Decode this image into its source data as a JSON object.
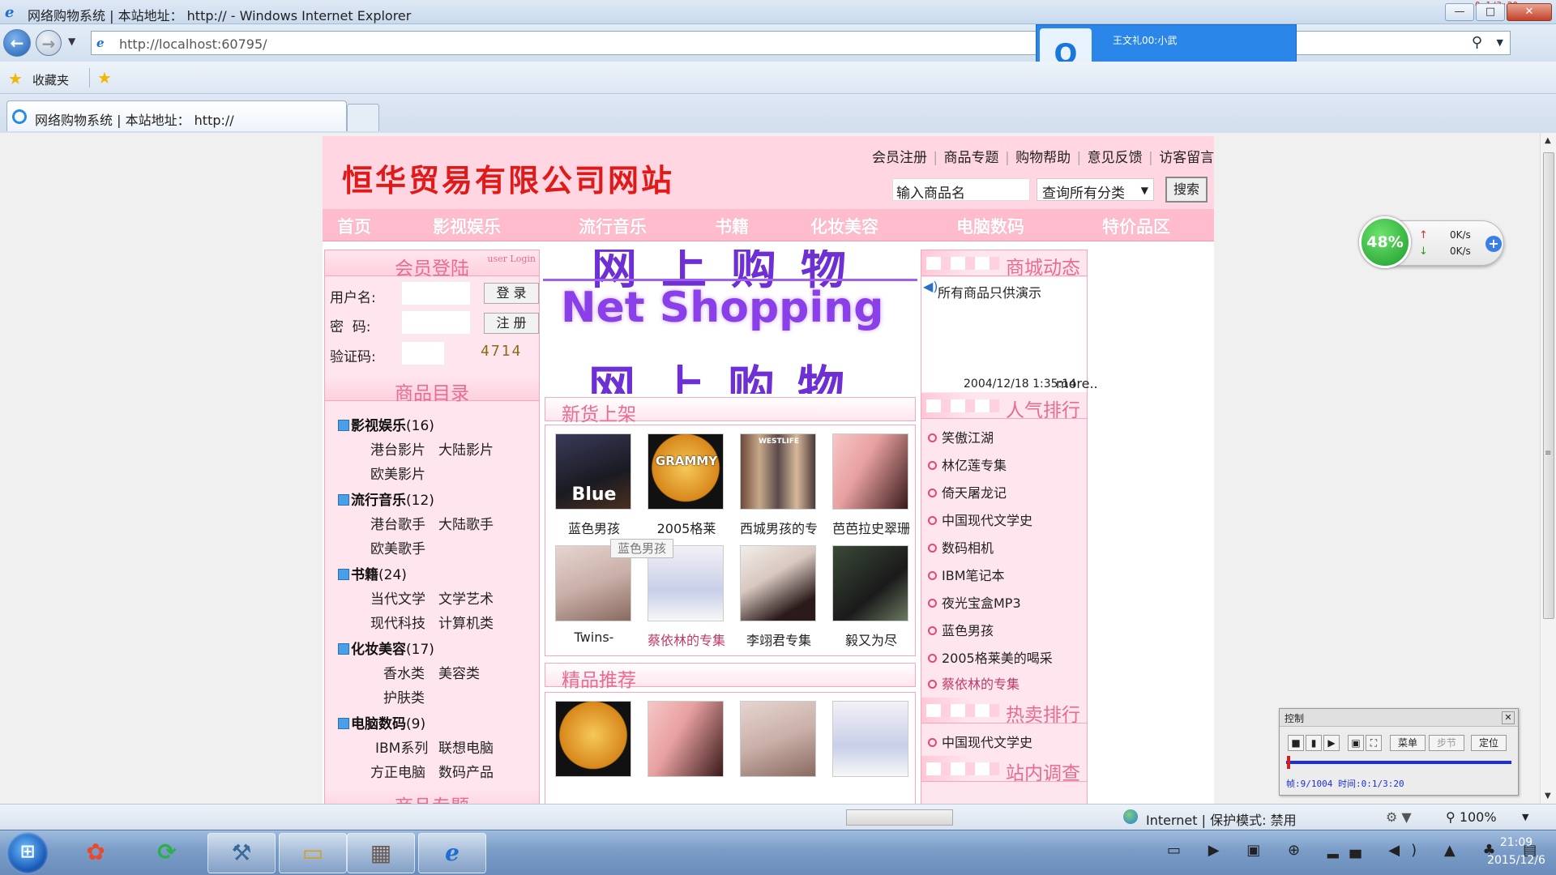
{
  "window": {
    "title": "网络购物系统 | 本站地址： http:// - Windows Internet Explorer",
    "minimize": "—",
    "maximize": "□",
    "close": "✕",
    "rec_time": "0:1/3:20"
  },
  "browser": {
    "url": "http://localhost:60795/",
    "favorites_label": "收藏夹",
    "tab_title": "网络购物系统 | 本站地址： http://"
  },
  "qq": {
    "avatar": "Q",
    "name": "王文礼00:小武"
  },
  "site": {
    "title": "恒华贸易有限公司网站",
    "top_links": [
      "会员注册",
      "商品专题",
      "购物帮助",
      "意见反馈",
      "访客留言"
    ],
    "search_placeholder": "输入商品名",
    "category_select": "查询所有分类",
    "search_button": "搜索",
    "nav": [
      "首页",
      "影视娱乐",
      "流行音乐",
      "书籍",
      "化妆美容",
      "电脑数码",
      "特价品区"
    ]
  },
  "login": {
    "title": "会员登陆",
    "subtitle": "user Login",
    "username_label": "用户名:",
    "password_label": "密  码:",
    "captcha_label": "验证码:",
    "login_button": "登 录",
    "register_button": "注 册",
    "captcha": "4714"
  },
  "catalog": {
    "title": "商品目录",
    "categories": [
      {
        "name": "影视娱乐",
        "count": "(16)",
        "subs": [
          "港台影片",
          "大陆影片",
          "欧美影片"
        ]
      },
      {
        "name": "流行音乐",
        "count": "(12)",
        "subs": [
          "港台歌手",
          "大陆歌手",
          "欧美歌手"
        ]
      },
      {
        "name": "书籍",
        "count": "(24)",
        "subs": [
          "当代文学",
          "文学艺术",
          "现代科技",
          "计算机类"
        ]
      },
      {
        "name": "化妆美容",
        "count": "(17)",
        "subs": [
          "香水类",
          "美容类",
          "护肤类"
        ]
      },
      {
        "name": "电脑数码",
        "count": "(9)",
        "subs": [
          "IBM系列",
          "联想电脑",
          "方正电脑",
          "数码产品"
        ]
      }
    ],
    "next_section": "商品专题"
  },
  "banner": {
    "line1": "网上购物",
    "line2": "Net Shopping",
    "line3": "网上购物"
  },
  "new_products": {
    "title": "新货上架",
    "items": [
      {
        "caption": "蓝色男孩",
        "cover_text": "Blue"
      },
      {
        "caption": "2005格莱",
        "cover_text": "GRAMMY"
      },
      {
        "caption": "西城男孩的专",
        "cover_text": "WESTLIFE"
      },
      {
        "caption": "芭芭拉史翠珊",
        "cover_text": ""
      },
      {
        "caption": "Twins-",
        "cover_text": ""
      },
      {
        "caption": "蔡依林的专集",
        "cover_text": ""
      },
      {
        "caption": "李翊君专集",
        "cover_text": ""
      },
      {
        "caption": "毅又为尽",
        "cover_text": ""
      }
    ],
    "tooltip": "蓝色男孩"
  },
  "featured": {
    "title": "精品推荐"
  },
  "news": {
    "title": "商城动态",
    "text": "所有商品只供演示",
    "date": "2004/12/18 1:35:14",
    "more": "more.."
  },
  "popular": {
    "title": "人气排行",
    "items": [
      "笑傲江湖",
      "林亿莲专集",
      "倚天屠龙记",
      "中国现代文学史",
      "数码相机",
      "IBM笔记本",
      "夜光宝盒MP3",
      "蓝色男孩",
      "2005格莱美的喝采",
      "蔡依林的专集"
    ]
  },
  "hot": {
    "title": "热卖排行",
    "items": [
      "中国现代文学史"
    ]
  },
  "survey": {
    "title": "站内调查"
  },
  "speed_widget": {
    "percent": "48%",
    "up": "0K/s",
    "down": "0K/s"
  },
  "control": {
    "title": "控制",
    "menu": "菜单",
    "step": "步节",
    "locate": "定位",
    "info": "帧:9/1004 时间:0:1/3:20",
    "progress": 0.005
  },
  "status": {
    "zone": "Internet | 保护模式: 禁用",
    "zoom": "100%"
  },
  "clock": {
    "time": "21:09",
    "date": "2015/12/6"
  }
}
